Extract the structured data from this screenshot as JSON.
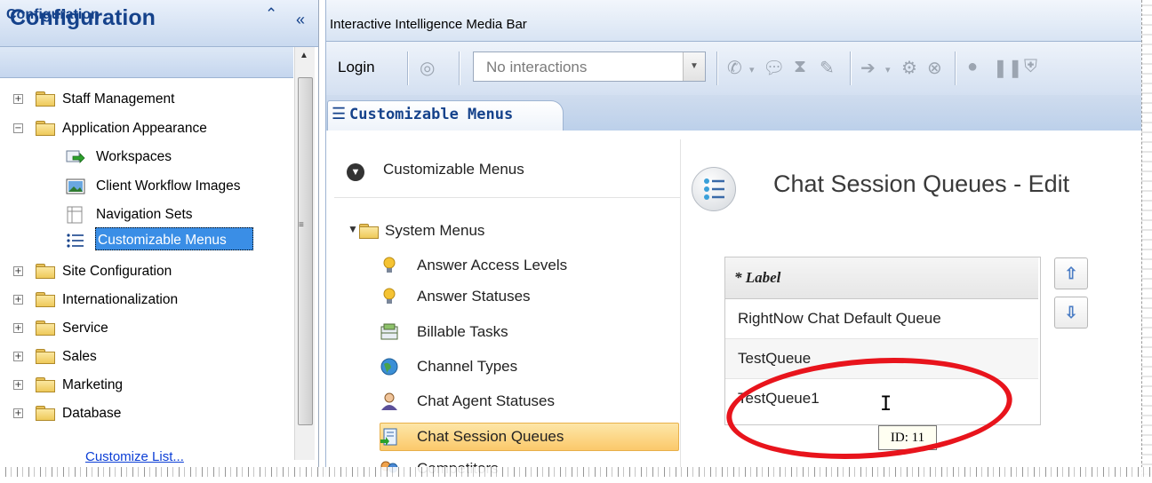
{
  "left_pane": {
    "title": "Configuration",
    "collapse_glyph": "«",
    "section_title": "Configuration",
    "section_collapse_glyph": "⌃",
    "tree": [
      {
        "label": "Staff Management",
        "expander": "+",
        "icon": "folder-icon"
      },
      {
        "label": "Application Appearance",
        "expander": "−",
        "icon": "folder-icon"
      },
      {
        "label": "Workspaces",
        "icon": "workspaces-icon"
      },
      {
        "label": "Client Workflow Images",
        "icon": "workflow-images-icon"
      },
      {
        "label": "Navigation Sets",
        "icon": "navigation-sets-icon"
      },
      {
        "label": "Customizable Menus",
        "icon": "customizable-menus-icon",
        "selected": true
      },
      {
        "label": "Site Configuration",
        "expander": "+",
        "icon": "folder-icon"
      },
      {
        "label": "Internationalization",
        "expander": "+",
        "icon": "folder-icon"
      },
      {
        "label": "Service",
        "expander": "+",
        "icon": "folder-icon"
      },
      {
        "label": "Sales",
        "expander": "+",
        "icon": "folder-icon"
      },
      {
        "label": "Marketing",
        "expander": "+",
        "icon": "folder-icon"
      },
      {
        "label": "Database",
        "expander": "+",
        "icon": "folder-icon"
      }
    ],
    "customize_link": "Customize List..."
  },
  "media_bar": {
    "title": "Interactive Intelligence Media Bar",
    "login_label": "Login",
    "interactions_value": "No interactions"
  },
  "tab": {
    "label": "Customizable Menus"
  },
  "menu_panel": {
    "header": "Customizable Menus",
    "system_menus": "System Menus",
    "items": [
      {
        "label": "Answer Access Levels",
        "icon": "lightbulb-icon"
      },
      {
        "label": "Answer Statuses",
        "icon": "lightbulb-icon"
      },
      {
        "label": "Billable Tasks",
        "icon": "calculator-icon"
      },
      {
        "label": "Channel Types",
        "icon": "globe-icon"
      },
      {
        "label": "Chat Agent Statuses",
        "icon": "agent-icon"
      },
      {
        "label": "Chat Session Queues",
        "icon": "queue-icon",
        "selected": true
      },
      {
        "label": "Competitors",
        "icon": "competitors-icon"
      }
    ]
  },
  "edit": {
    "title": "Chat Session Queues - Edit",
    "column_header": "* Label",
    "rows": [
      "RightNow Chat Default Queue",
      "TestQueue",
      "TestQueue1"
    ],
    "tooltip": "ID: 11"
  },
  "colors": {
    "accent": "#15428b",
    "selection": "#3a8ee6",
    "annotation": "#e8141c"
  }
}
